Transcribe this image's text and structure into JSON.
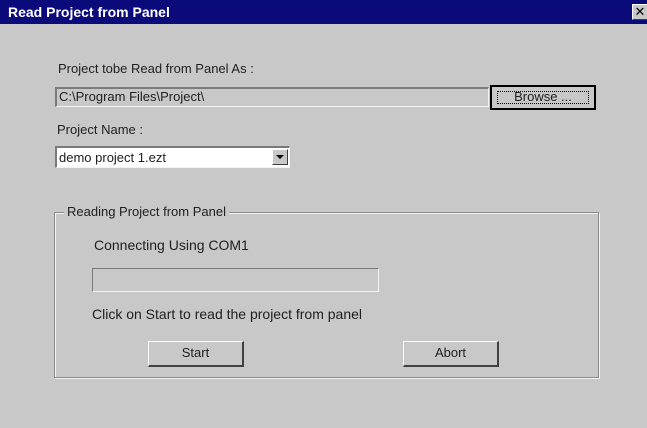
{
  "window": {
    "title": "Read Project from Panel",
    "close_glyph": "✕"
  },
  "form": {
    "path_label": "Project tobe Read from Panel As :",
    "path_value": "C:\\Program Files\\Project\\",
    "browse_label": "Browse ...",
    "project_name_label": "Project Name :",
    "project_name_value": "demo project 1.ezt"
  },
  "group": {
    "title": "Reading Project from Panel",
    "connection_status": "Connecting Using COM1",
    "progress_fraction": 0,
    "instruction": "Click on Start to read the project from panel",
    "start_label": "Start",
    "abort_label": "Abort"
  },
  "colors": {
    "titlebar": "#0b0a7a",
    "face": "#c8c8c8"
  }
}
